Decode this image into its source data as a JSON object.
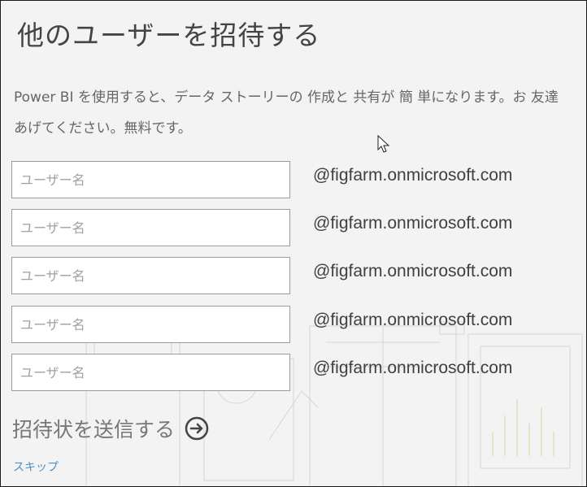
{
  "dialog": {
    "title": "他のユーザーを招待する",
    "description": "Power BI を使用すると、データ ストーリーの 作成と 共有が 簡 単になります。お 友達\nあげてください。無料です。"
  },
  "invite_rows": [
    {
      "placeholder": "ユーザー名",
      "domain": "@figfarm.onmicrosoft.com"
    },
    {
      "placeholder": "ユーザー名",
      "domain": "@figfarm.onmicrosoft.com"
    },
    {
      "placeholder": "ユーザー名",
      "domain": "@figfarm.onmicrosoft.com"
    },
    {
      "placeholder": "ユーザー名",
      "domain": "@figfarm.onmicrosoft.com"
    },
    {
      "placeholder": "ユーザー名",
      "domain": "@figfarm.onmicrosoft.com"
    }
  ],
  "send": {
    "label": "招待状を送信する",
    "icon": "arrow-right-circle-icon"
  },
  "skip_label": "スキップ",
  "colors": {
    "background": "#f3f3f3",
    "link": "#4a90c8",
    "text": "#444444"
  }
}
